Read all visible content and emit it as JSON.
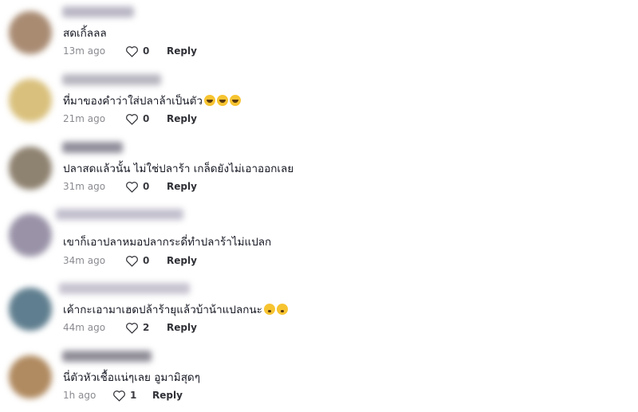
{
  "comments": [
    {
      "text": "สดเกิ้ลลล",
      "emojis": [],
      "time": "13m ago",
      "likes": "0",
      "reply_label": "Reply",
      "avatar_color": "#a98b72",
      "username_color": "#b9b6c4"
    },
    {
      "text": "ที่มาของคำว่าใส่ปลาล้าเป็นตัว",
      "emojis": [
        "joy-emoji",
        "joy-emoji",
        "joy-emoji"
      ],
      "time": "21m ago",
      "likes": "0",
      "reply_label": "Reply",
      "avatar_color": "#d9c07c",
      "username_color": "#b7b6c0"
    },
    {
      "text": "ปลาสดแล้วนั้น ไม่ใช่ปลาร้า เกล็ดยังไม่เอาออกเลย",
      "emojis": [],
      "time": "31m ago",
      "likes": "0",
      "reply_label": "Reply",
      "avatar_color": "#8e8270",
      "username_color": "#8f8d99"
    },
    {
      "text": "เขาก็เอาปลาหมอปลากระดี่ทำปลาร้าไม่แปลก",
      "emojis": [],
      "time": "34m ago",
      "likes": "0",
      "reply_label": "Reply",
      "avatar_color": "#9a93a8",
      "username_color": "#c2bfcd"
    },
    {
      "text": "เค้ากะเอามาเฮดปล้าร้ายุแล้วบ้าน้าแปลกนะ",
      "emojis": [
        "flushed-emoji",
        "flushed-emoji"
      ],
      "time": "44m ago",
      "likes": "2",
      "reply_label": "Reply",
      "avatar_color": "#5f7e8f",
      "username_color": "#c6c2cf"
    },
    {
      "text": "นี่ตัวหัวเชื้อแน่ๆเลย อูมามิสุดๆ",
      "emojis": [],
      "time": "1h ago",
      "likes": "1",
      "reply_label": "Reply",
      "avatar_color": "#b08a60",
      "username_color": "#8e8b96"
    }
  ]
}
